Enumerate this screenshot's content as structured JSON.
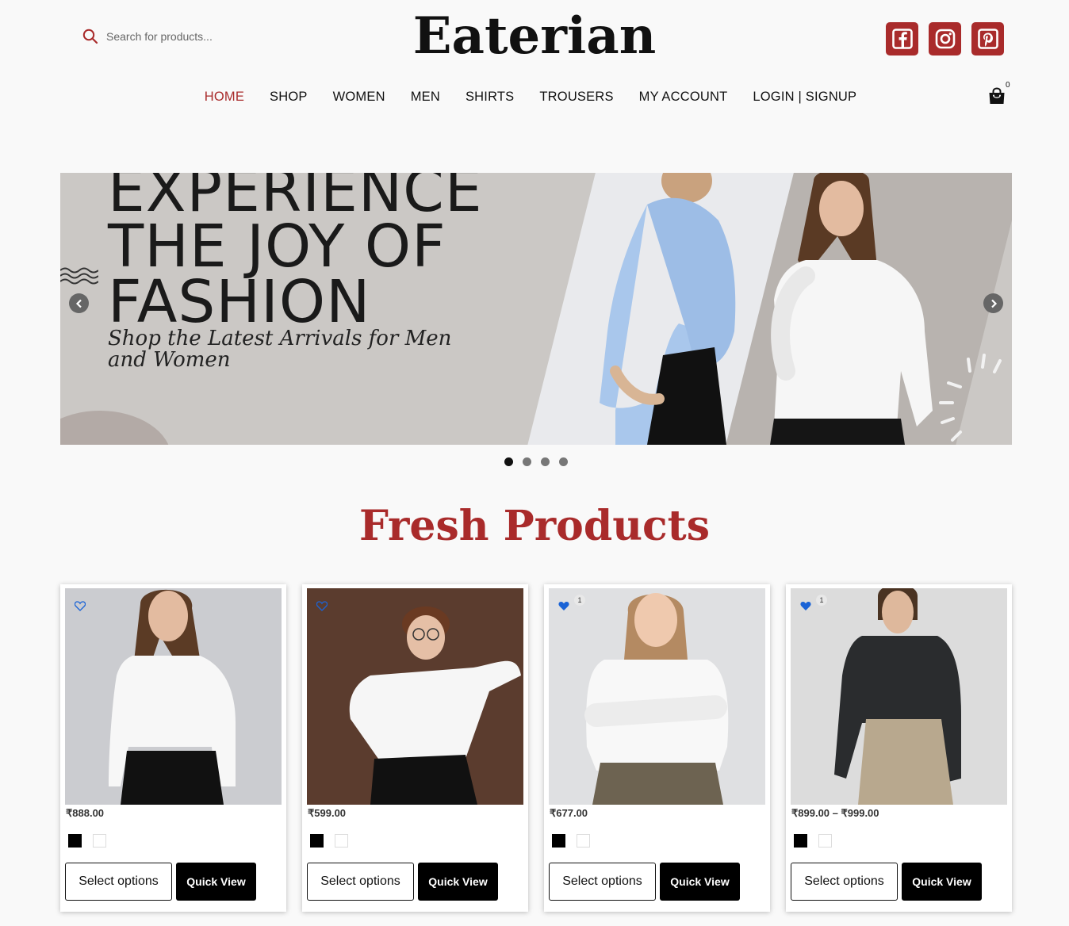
{
  "header": {
    "search_placeholder": "Search for products...",
    "logo": "Eaterian",
    "social": [
      "facebook-icon",
      "instagram-icon",
      "pinterest-icon"
    ],
    "brand_color": "#a92b2b"
  },
  "nav": {
    "items": [
      {
        "label": "HOME",
        "active": true
      },
      {
        "label": "SHOP"
      },
      {
        "label": "WOMEN"
      },
      {
        "label": "MEN"
      },
      {
        "label": "SHIRTS"
      },
      {
        "label": "TROUSERS"
      },
      {
        "label": "MY ACCOUNT"
      },
      {
        "label": "LOGIN | SIGNUP"
      }
    ],
    "cart_count": "0"
  },
  "hero": {
    "line1": "EXPERIENCE",
    "line2": "THE JOY OF",
    "line3": "FASHION",
    "sub1": "Shop the Latest Arrivals for Men",
    "sub2": "and Women",
    "active_slide": 1,
    "slide_count": 4
  },
  "section": {
    "title": "Fresh Products"
  },
  "products": [
    {
      "price": "₹888.00",
      "wishlisted": false,
      "wish_count": "",
      "select_label": "Select options",
      "quick_label": "Quick View",
      "swatches": [
        "black",
        "white"
      ]
    },
    {
      "price": "₹599.00",
      "wishlisted": false,
      "wish_count": "",
      "select_label": "Select options",
      "quick_label": "Quick View",
      "swatches": [
        "black",
        "white"
      ]
    },
    {
      "price": "₹677.00",
      "wishlisted": true,
      "wish_count": "1",
      "select_label": "Select options",
      "quick_label": "Quick View",
      "swatches": [
        "black",
        "white"
      ]
    },
    {
      "price": "₹899.00 – ₹999.00",
      "wishlisted": true,
      "wish_count": "1",
      "select_label": "Select options",
      "quick_label": "Quick View",
      "swatches": [
        "black",
        "white"
      ]
    }
  ]
}
